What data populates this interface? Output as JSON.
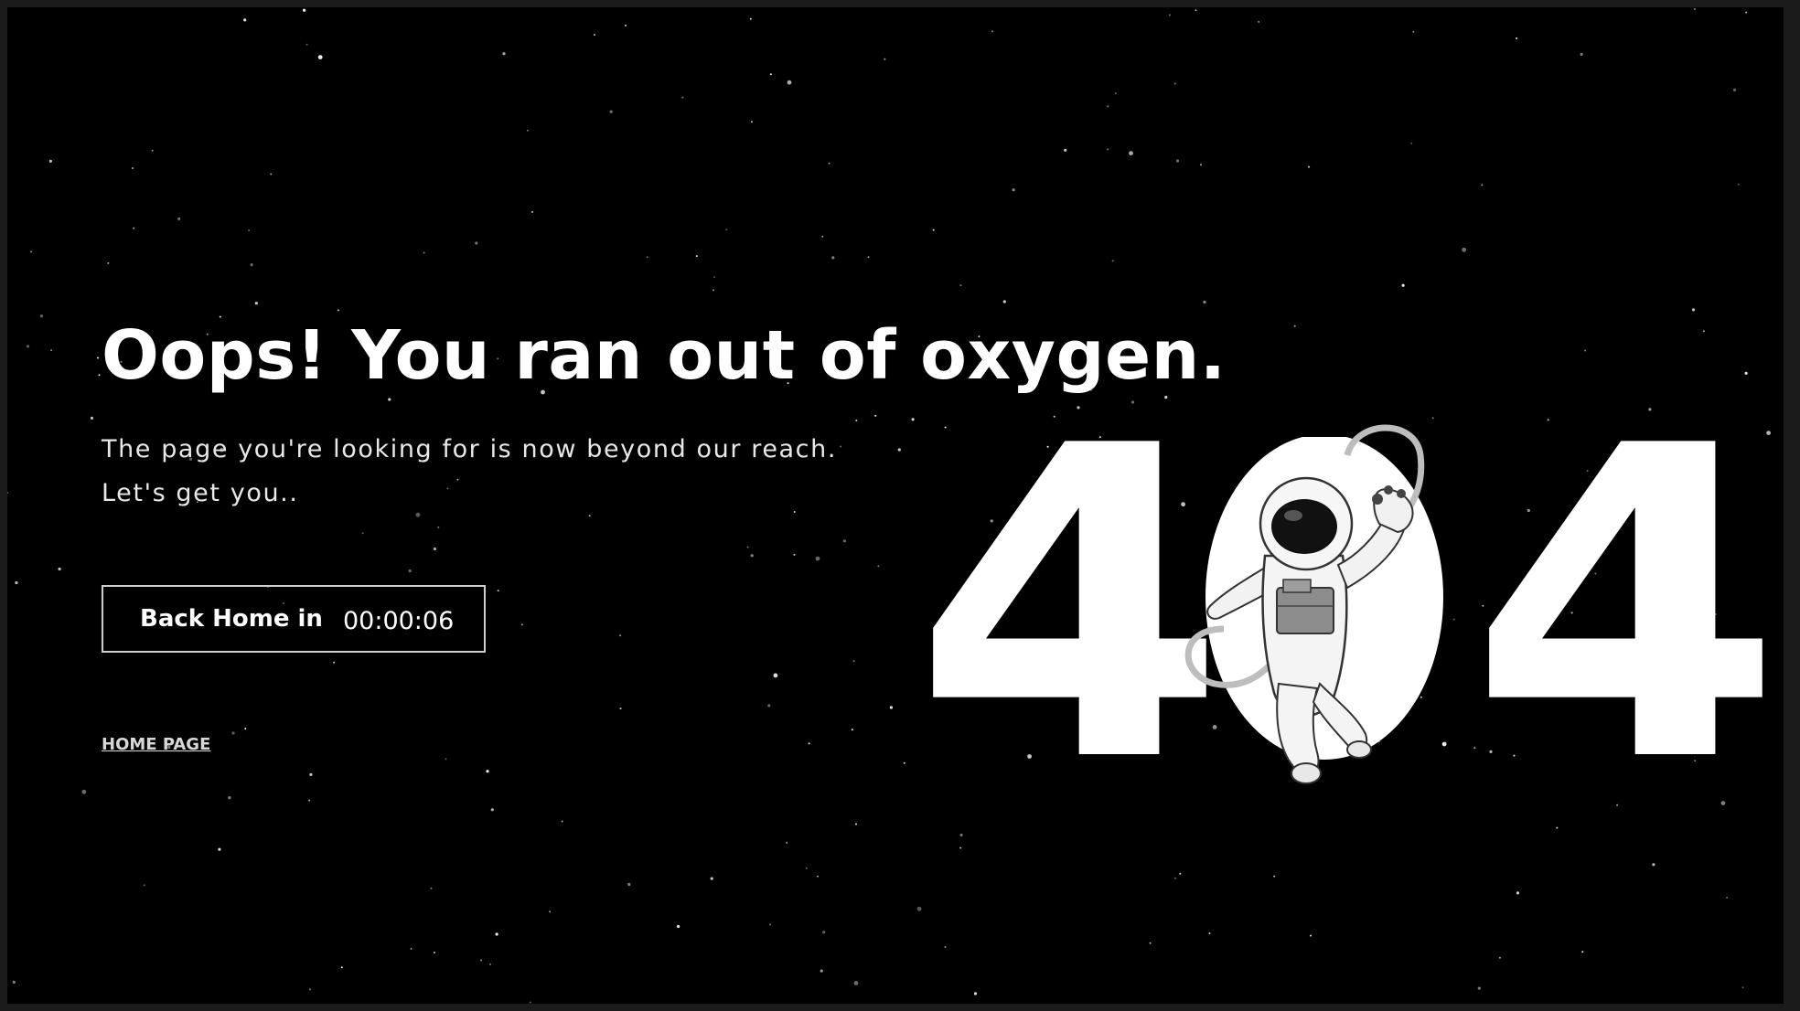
{
  "headline": "Oops! You ran out of oxygen.",
  "message": {
    "line1": "The page you're looking for is now beyond our reach.",
    "line2": "Let's get you.."
  },
  "countdown": {
    "label": "Back Home in",
    "timer": "00:00:06"
  },
  "home_link": "HOME PAGE",
  "error_code": {
    "first": "4",
    "last": "4"
  },
  "colors": {
    "background": "#000000",
    "text": "#ffffff",
    "frame": "#1b1b1b"
  },
  "illustration": "astronaut-illustration"
}
